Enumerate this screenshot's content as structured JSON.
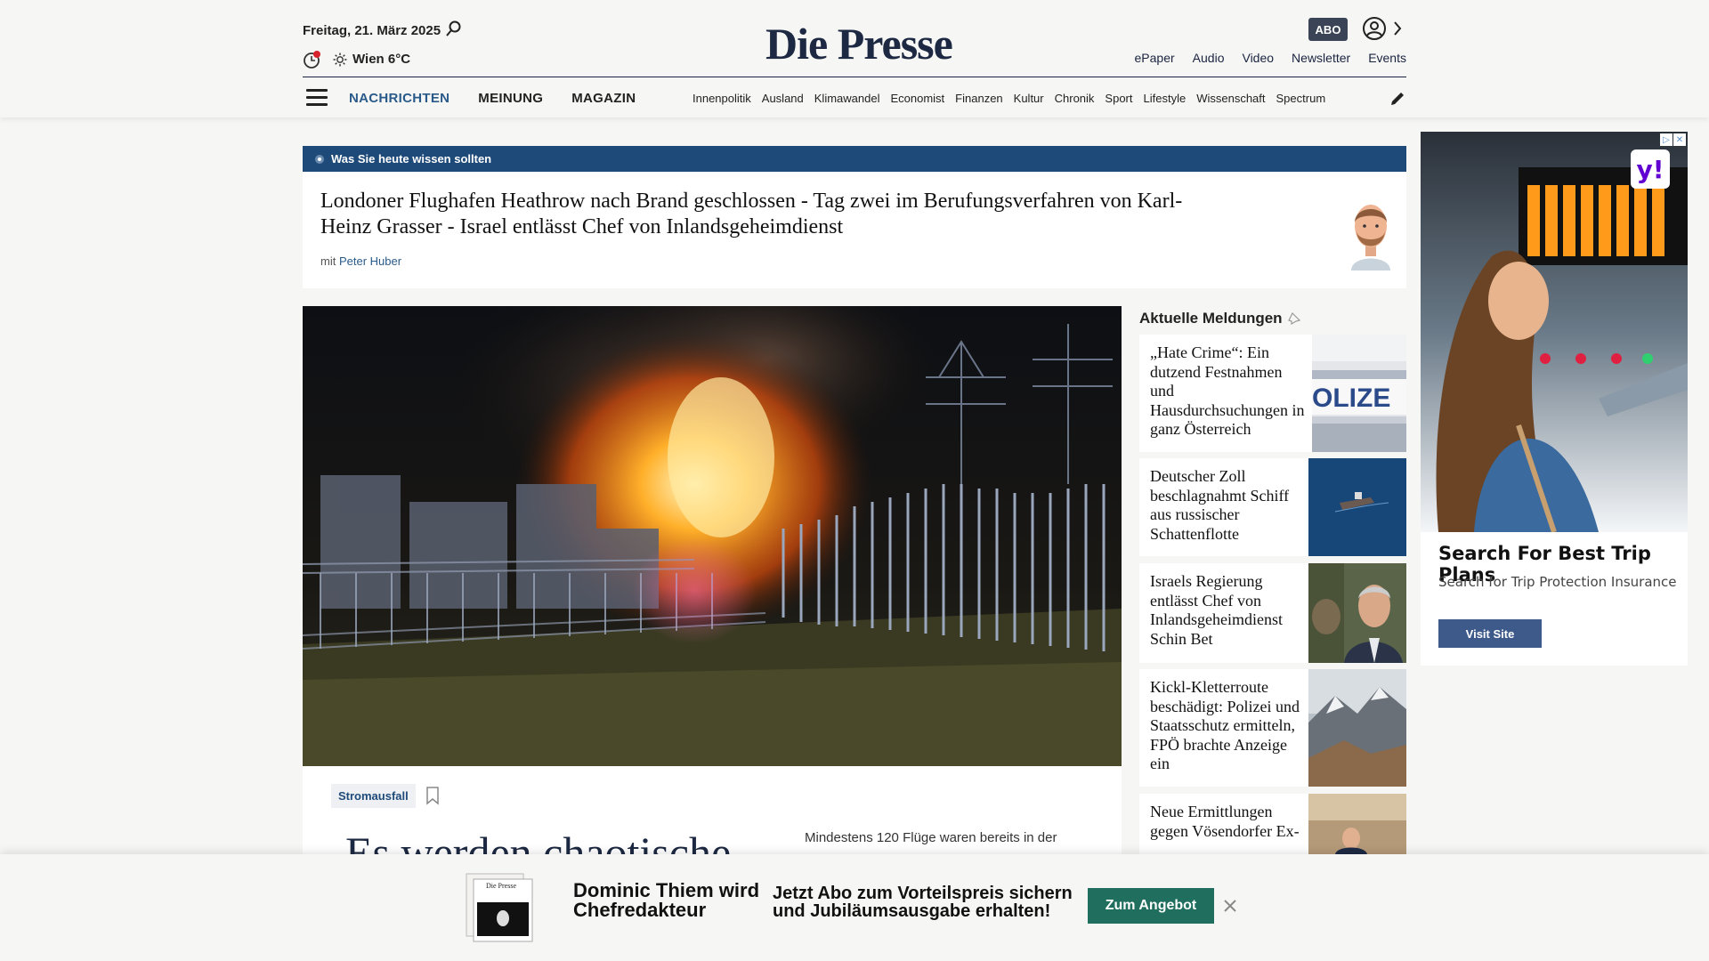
{
  "header": {
    "date": "Freitag, 21. März 2025",
    "weather": "Wien 6°C",
    "logo": "Die Presse",
    "abo_label": "ABO",
    "top_links": [
      "ePaper",
      "Audio",
      "Video",
      "Newsletter",
      "Events"
    ],
    "main_nav": [
      "NACHRICHTEN",
      "MEINUNG",
      "MAGAZIN"
    ],
    "sub_nav": [
      "Innenpolitik",
      "Ausland",
      "Klimawandel",
      "Economist",
      "Finanzen",
      "Kultur",
      "Chronik",
      "Sport",
      "Lifestyle",
      "Wissenschaft",
      "Spectrum"
    ]
  },
  "briefing": {
    "label": "Was Sie heute wissen sollten",
    "title": "Londoner Flughafen Heathrow nach Brand geschlossen - Tag zwei im Berufungsverfahren von Karl-Heinz Grasser - Israel entlässt Chef von Inlandsgeheimdienst",
    "author_prefix": "mit",
    "author": "Peter Huber"
  },
  "main_story": {
    "tag": "Stromausfall",
    "headline": "Es werden chaotische",
    "teaser": "Mindestens 120 Flüge waren bereits in der"
  },
  "side": {
    "title": "Aktuelle Meldungen",
    "items": [
      "„Hate Crime“: Ein dutzend Festnahmen und Hausdurchsuchungen in ganz Österreich",
      "Deutscher Zoll beschlagnahmt Schiff aus russischer Schattenflotte",
      "Israels Regierung entlässt Chef von Inlandsgeheimdienst Schin Bet",
      "Kickl-Kletterroute beschädigt: Polizei und Staatsschutz ermitteln, FPÖ brachte Anzeige ein",
      "Neue Ermittlungen gegen Vösendorfer Ex-"
    ],
    "image_texts": [
      "OLIZE"
    ]
  },
  "ad": {
    "title": "Search For Best Trip Plans",
    "subtitle": "Search for Trip Protection Insurance",
    "button": "Visit Site",
    "logo": "y!"
  },
  "banner": {
    "name": "Dominic Thiem wird Chefredakteur",
    "offer": "Jetzt Abo zum Vorteilspreis sichern und Jubiläumsausgabe erhalten!",
    "button": "Zum Angebot",
    "thumb_logo": "Die Presse"
  },
  "colors": {
    "brand_navy": "#1d2942",
    "accent_blue": "#1e4a7a",
    "cta_green": "#1f6e5e"
  }
}
